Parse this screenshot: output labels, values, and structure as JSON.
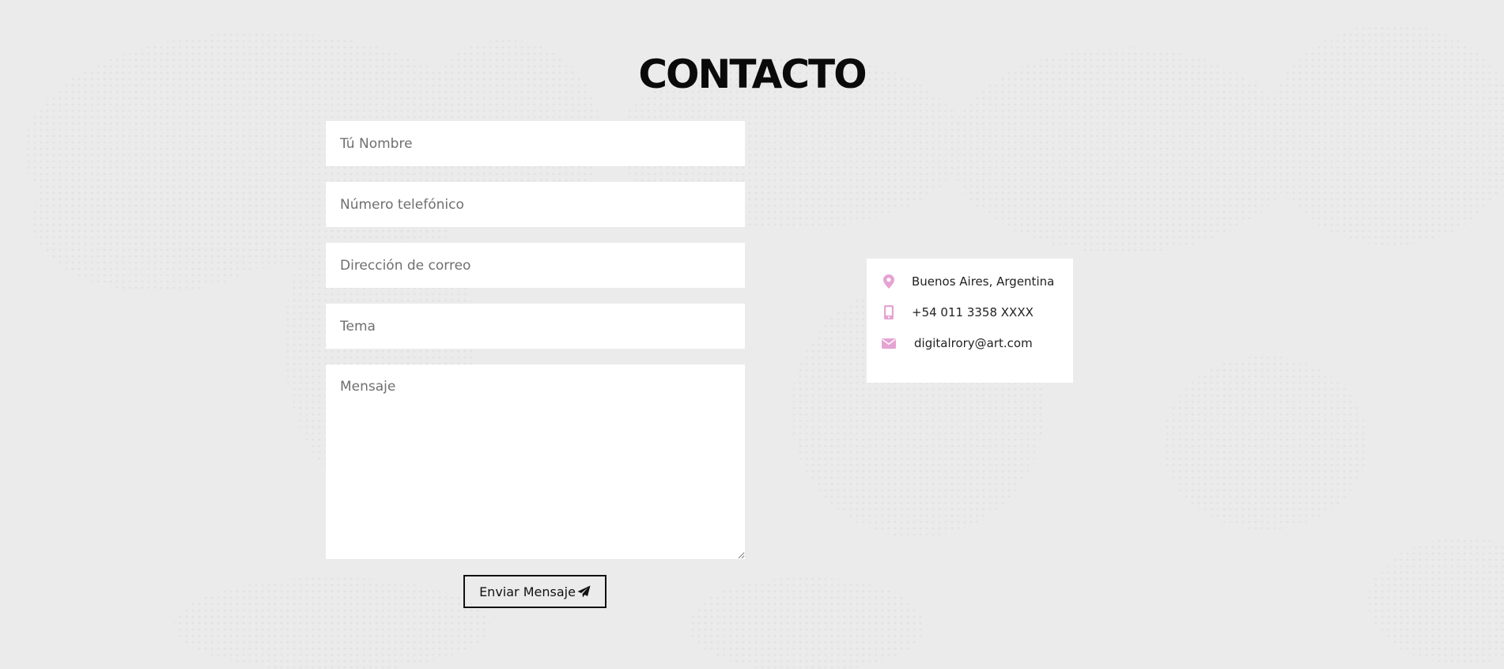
{
  "section": {
    "title": "CONTACTO"
  },
  "form": {
    "name_placeholder": "Tú Nombre",
    "phone_placeholder": "Número telefónico",
    "email_placeholder": "Dirección de correo",
    "subject_placeholder": "Tema",
    "message_placeholder": "Mensaje",
    "submit_label": "Enviar Mensaje",
    "submit_icon": "paper-plane-icon"
  },
  "contact_info": {
    "location": {
      "icon": "map-marker-icon",
      "text": "Buenos Aires, Argentina"
    },
    "phone": {
      "icon": "mobile-phone-icon",
      "text": "+54 011 3358 XXXX"
    },
    "email": {
      "icon": "envelope-icon",
      "text": "digitalrory@art.com"
    }
  },
  "colors": {
    "background": "#ebebeb",
    "accent": "#e5a3d2",
    "text": "#0a0a0a",
    "field_background": "#ffffff"
  }
}
